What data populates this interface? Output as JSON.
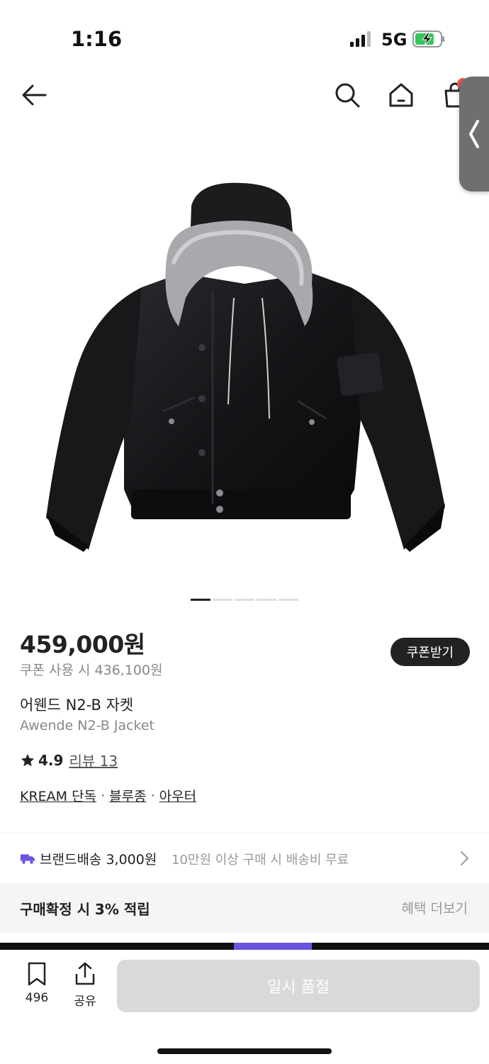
{
  "status_bar": {
    "time": "1:16",
    "network": "5G"
  },
  "product": {
    "price": "459,000원",
    "coupon_price_text": "쿠폰 사용 시 436,100원",
    "coupon_button": "쿠폰받기",
    "name_ko": "어웬드 N2-B 자켓",
    "name_en": "Awende N2-B Jacket",
    "rating": "4.9",
    "reviews_label": "리뷰 13",
    "tags": [
      "KREAM 단독",
      "블루종",
      "아우터"
    ]
  },
  "image_pager": {
    "total": 5,
    "active_index": 0
  },
  "shipping": {
    "label": "브랜드배송 3,000원",
    "note": "10만원 이상 구매 시 배송비 무료"
  },
  "benefit": {
    "text": "구매확정 시 3% 적립",
    "link": "혜택 더보기"
  },
  "bottom_bar": {
    "bookmark_count": "496",
    "share_label": "공유",
    "soldout_label": "일시 품절"
  },
  "colors": {
    "accent_dark": "#222222",
    "shipping_icon": "#6a54e0",
    "cart_badge": "#f0524a",
    "soldout_bg": "#d9d9d9"
  },
  "icons": {
    "back": "arrow-left-icon",
    "search": "search-icon",
    "home": "home-icon",
    "bag": "shopping-bag-icon",
    "shipping": "truck-icon",
    "chevron": "chevron-right-icon",
    "bookmark": "bookmark-icon",
    "share": "share-icon"
  }
}
